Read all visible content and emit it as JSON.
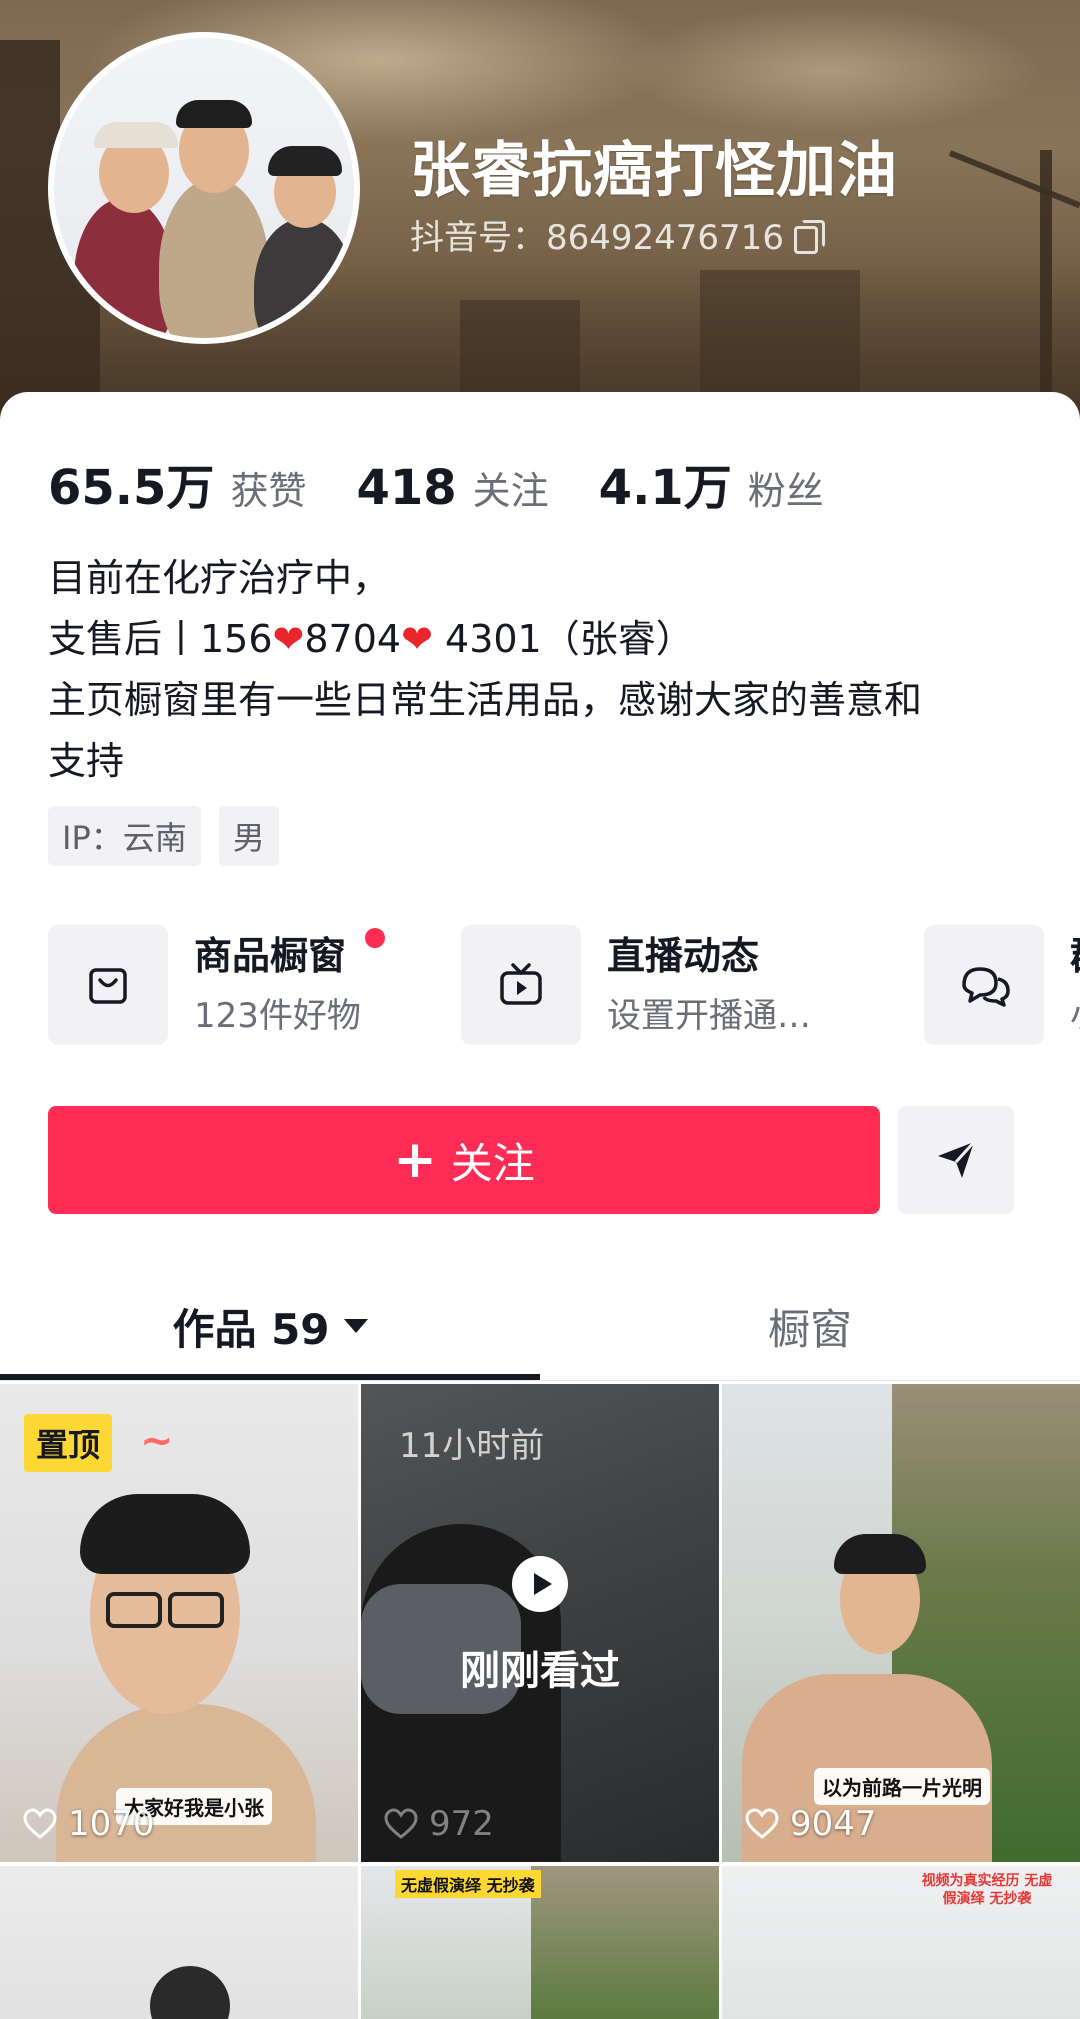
{
  "profile": {
    "nickname": "张睿抗癌打怪加油",
    "douyin_id": "抖音号：86492476716",
    "stats": [
      {
        "value": "65.5万",
        "label": "获赞"
      },
      {
        "value": "418",
        "label": "关注"
      },
      {
        "value": "4.1万",
        "label": "粉丝"
      }
    ],
    "bio": {
      "line1": "目前在化疗治疗中，",
      "line2_prefix": "支售后丨156",
      "line2_mid": "8704",
      "line2_suffix": " 4301（张睿）",
      "line3": "主页橱窗里有一些日常生活用品，感谢大家的善意和",
      "line4": "支持"
    },
    "tags": [
      "IP：云南",
      "男"
    ]
  },
  "entries": [
    {
      "title": "商品橱窗",
      "subtitle": "123件好物",
      "icon": "shopping-bag-icon"
    },
    {
      "title": "直播动态",
      "subtitle": "设置开播通…",
      "icon": "tv-icon"
    },
    {
      "title": "群",
      "subtitle": "小",
      "icon": "chat-bubbles-icon"
    }
  ],
  "actions": {
    "follow_label": "关注",
    "share_icon": "send-icon"
  },
  "tabs": {
    "works_label": "作品 59",
    "shop_label": "橱窗"
  },
  "videos": [
    {
      "badge": "置顶",
      "likes": "1070",
      "caption": "大家好我是小张"
    },
    {
      "time_ago": "11小时前",
      "overlay": "刚刚看过",
      "likes": "972"
    },
    {
      "likes": "9047",
      "caption": "以为前路一片光明"
    },
    {
      "banner": ""
    },
    {
      "banner": "无虚假演绎 无抄袭"
    },
    {
      "banner": "视频为真实经历 无虚假演绎 无抄袭"
    }
  ],
  "colors": {
    "accent": "#fe2c55",
    "badge": "#fdd835",
    "text_primary": "#161823",
    "text_secondary": "#6b6e78"
  }
}
